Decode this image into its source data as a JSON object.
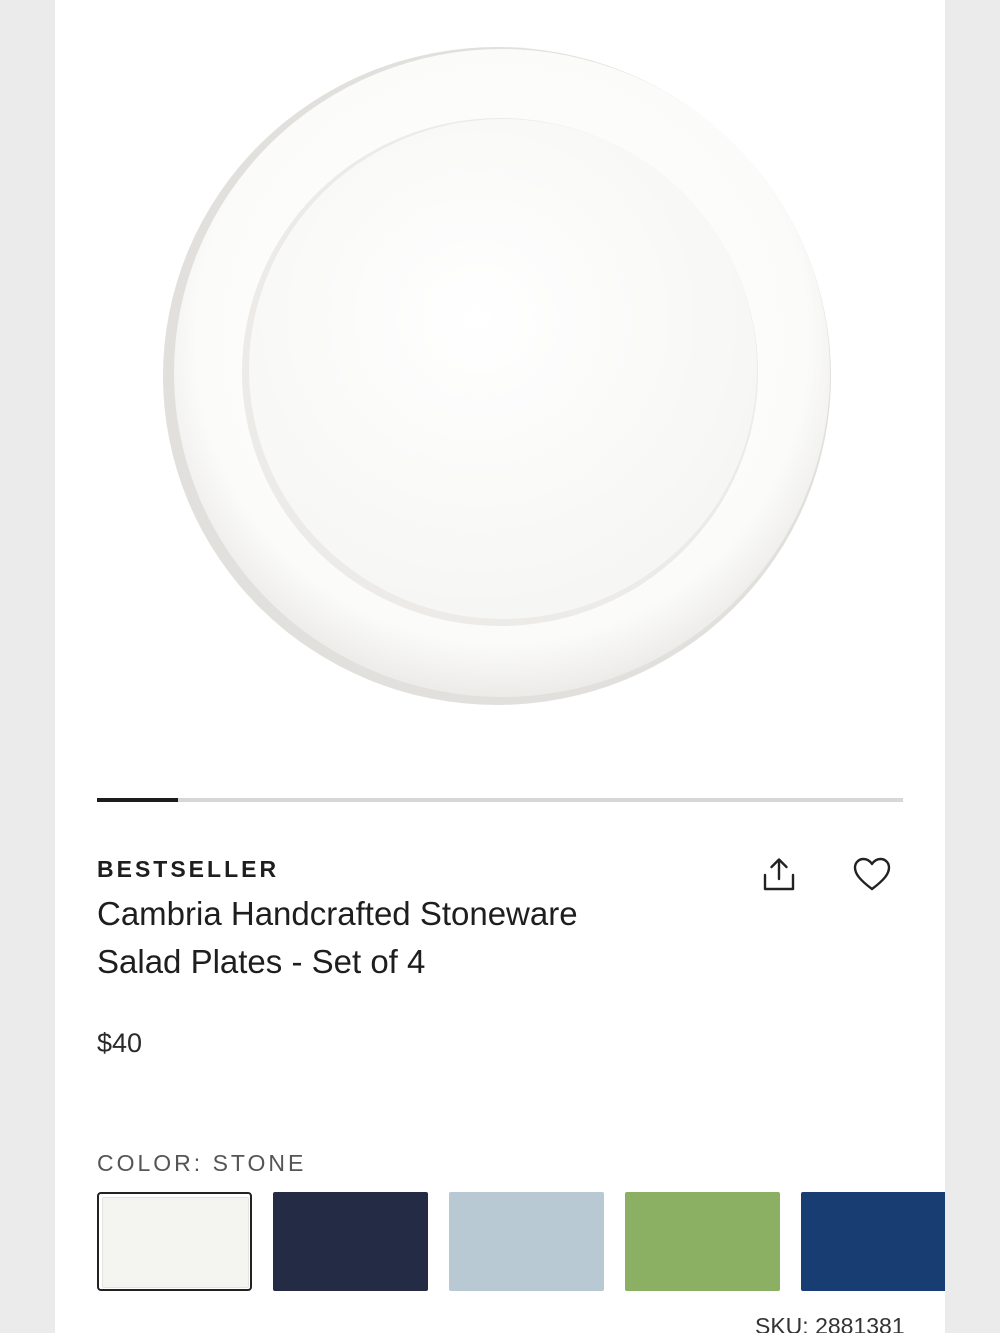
{
  "product": {
    "badge": "BESTSELLER",
    "title_line1": "Cambria Handcrafted Stoneware",
    "title_line2": "Salad Plates - Set of 4",
    "price": "$40",
    "sku": "SKU: 2881381",
    "image_alt": "White stoneware salad plate"
  },
  "gallery": {
    "progress": 0.1
  },
  "actions": {
    "share_icon": "share-icon",
    "favorite_icon": "heart-icon"
  },
  "color": {
    "label": "COLOR: STONE",
    "selected": "Stone",
    "swatches": [
      {
        "name": "Stone",
        "hex": "#f4f4f1",
        "selected": true
      },
      {
        "name": "Navy",
        "hex": "#242b45",
        "selected": false
      },
      {
        "name": "Light Blue",
        "hex": "#b8c9d4",
        "selected": false
      },
      {
        "name": "Green",
        "hex": "#8bb063",
        "selected": false
      },
      {
        "name": "Blue",
        "hex": "#183d72",
        "selected": false
      }
    ]
  }
}
